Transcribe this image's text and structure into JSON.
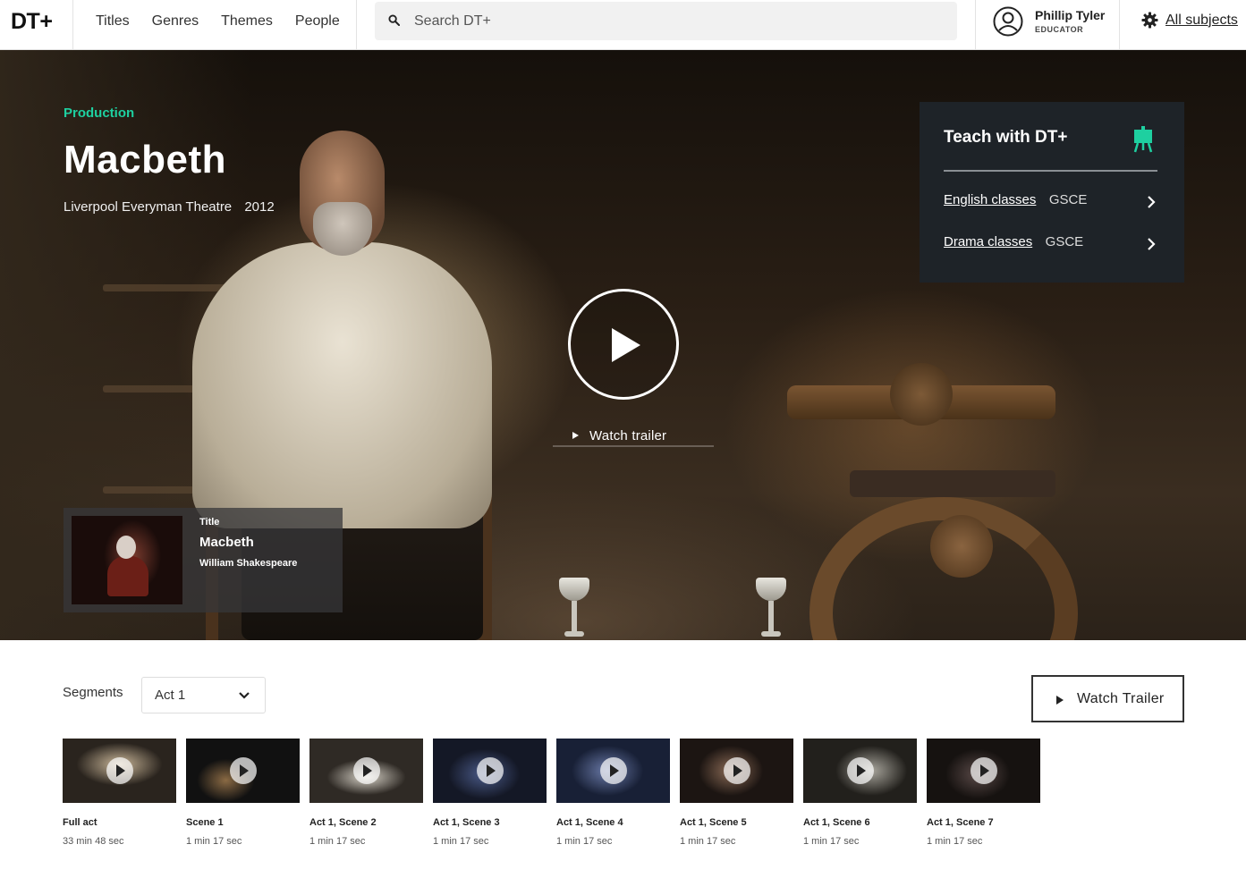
{
  "nav": {
    "logo": "DT+",
    "links": [
      "Titles",
      "Genres",
      "Themes",
      "People"
    ],
    "search_placeholder": "Search DT+",
    "user_name": "Phillip Tyler",
    "user_role": "EDUCATOR",
    "subjects_label": "All subjects"
  },
  "hero": {
    "eyebrow": "Production",
    "title": "Macbeth",
    "venue": "Liverpool Everyman Theatre",
    "year": "2012",
    "watch_trailer": "Watch trailer",
    "accent_color": "#1ed0a0"
  },
  "teach": {
    "heading": "Teach with DT+",
    "rows": [
      {
        "link": "English classes",
        "level": "GSCE"
      },
      {
        "link": "Drama classes",
        "level": "GSCE"
      }
    ]
  },
  "title_card": {
    "label": "Title",
    "name": "Macbeth",
    "author": "William Shakespeare"
  },
  "segments": {
    "label": "Segments",
    "selected": "Act 1",
    "watch_trailer_button": "Watch Trailer",
    "items": [
      {
        "name": "Full act",
        "duration": "33 min 48 sec"
      },
      {
        "name": "Scene 1",
        "duration": "1 min 17 sec"
      },
      {
        "name": "Act 1, Scene 2",
        "duration": "1 min 17 sec"
      },
      {
        "name": "Act 1, Scene 3",
        "duration": "1 min 17 sec"
      },
      {
        "name": "Act 1, Scene 4",
        "duration": "1 min 17 sec"
      },
      {
        "name": "Act 1, Scene 5",
        "duration": "1 min 17 sec"
      },
      {
        "name": "Act 1, Scene 6",
        "duration": "1 min 17 sec"
      },
      {
        "name": "Act 1, Scene 7",
        "duration": "1 min 17 sec"
      }
    ]
  }
}
